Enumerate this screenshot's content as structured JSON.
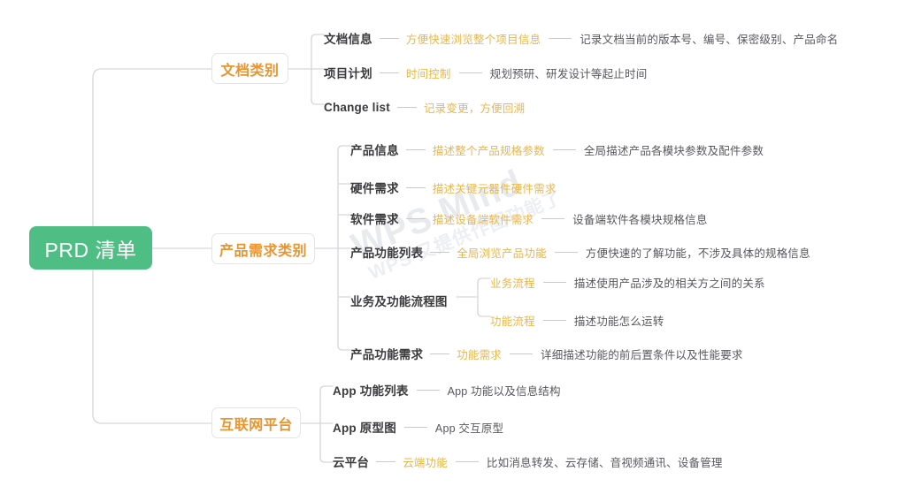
{
  "diagram": {
    "title": "PRD 清单",
    "type": "mind-map",
    "watermark": {
      "line1": "WPS Mind",
      "line2": "WPS 又提供作图功能了"
    },
    "colors": {
      "root_fill": "#4fbe85",
      "root_text": "#ffffff",
      "category_text": "#e8952f",
      "category_border": "#e3e4e8",
      "level2_text": "#3b3b3d",
      "level3_text": "#e9b64a",
      "level4_text": "#58585c",
      "connector": "#d5d6d9"
    }
  },
  "root": {
    "label": "PRD 清单"
  },
  "branches": [
    {
      "id": "doc",
      "label": "文档类别",
      "items": [
        {
          "l2": "文档信息",
          "l3": "方便快速浏览整个项目信息",
          "l4": "记录文档当前的版本号、编号、保密级别、产品命名"
        },
        {
          "l2": "项目计划",
          "l3": "时间控制",
          "l4": "规划预研、研发设计等起止时间"
        },
        {
          "l2": "Change list",
          "l3": "记录变更，方便回溯",
          "l4": ""
        }
      ]
    },
    {
      "id": "product",
      "label": "产品需求类别",
      "items": [
        {
          "l2": "产品信息",
          "l3": "描述整个产品规格参数",
          "l4": "全局描述产品各模块参数及配件参数"
        },
        {
          "l2": "硬件需求",
          "l3": "描述关键元器件硬件需求",
          "l4": ""
        },
        {
          "l2": "软件需求",
          "l3": "描述设备端软件需求",
          "l4": "设备端软件各模块规格信息"
        },
        {
          "l2": "产品功能列表",
          "l3": "全局浏览产品功能",
          "l4": "方便快速的了解功能，不涉及具体的规格信息"
        },
        {
          "l2": "业务及功能流程图",
          "children": [
            {
              "l3": "业务流程",
              "l4": "描述使用产品涉及的相关方之间的关系"
            },
            {
              "l3": "功能流程",
              "l4": "描述功能怎么运转"
            }
          ]
        },
        {
          "l2": "产品功能需求",
          "l3": "功能需求",
          "l4": "详细描述功能的前后置条件以及性能要求"
        }
      ]
    },
    {
      "id": "internet",
      "label": "互联网平台",
      "items": [
        {
          "l2": "App 功能列表",
          "l3": "",
          "l4": "App 功能以及信息结构"
        },
        {
          "l2": "App 原型图",
          "l3": "",
          "l4": "App 交互原型"
        },
        {
          "l2": "云平台",
          "l3": "云端功能",
          "l4": "比如消息转发、云存储、音视频通讯、设备管理"
        }
      ]
    }
  ]
}
